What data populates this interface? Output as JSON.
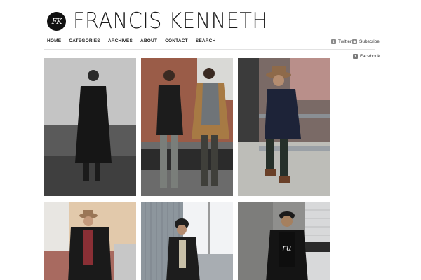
{
  "header": {
    "logo_mark": "FK",
    "site_title": "FRANCIS KENNETH"
  },
  "nav": {
    "items": [
      {
        "label": "HOME"
      },
      {
        "label": "CATEGORIES"
      },
      {
        "label": "ARCHIVES"
      },
      {
        "label": "ABOUT"
      },
      {
        "label": "CONTACT"
      },
      {
        "label": "SEARCH"
      }
    ]
  },
  "social": {
    "twitter": "Twitter",
    "subscribe": "Subscribe",
    "facebook": "Facebook"
  }
}
